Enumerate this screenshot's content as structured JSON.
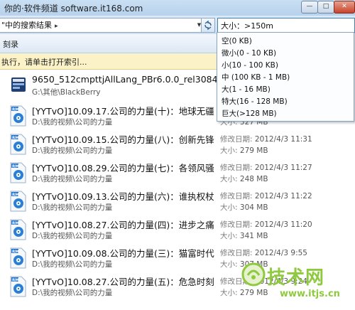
{
  "watermark_top": "你的·软件频道 software.it168.com",
  "window_buttons": {
    "minimize": "—",
    "maximize": "□",
    "close": "✕"
  },
  "address_bar": {
    "text": "\"中的搜索结果",
    "separator": "▸"
  },
  "search": {
    "value": "大小：>150m"
  },
  "toolbar": {
    "label": "刻录"
  },
  "infobar": {
    "text": "执行，请单击打开索引..."
  },
  "size_filter": {
    "options": [
      "空(0 KB)",
      "微小(0 - 10 KB)",
      "小(10 - 100 KB)",
      "中 (100 KB - 1 MB)",
      "大(1 - 16 MB)",
      "特大(16 - 128 MB)",
      "巨大(>128 MB)"
    ]
  },
  "files": [
    {
      "name": "9650_512cmpttjAllLang_PBr6.0.0_rel3084...",
      "path": "G:\\其他\\BlackBerry",
      "date_label": "",
      "date": "",
      "size_label": "",
      "size": "",
      "icon": "blackberry-package-icon"
    },
    {
      "name": "[YYTvO]10.09.17.公司的力量(十)：地球无疆",
      "path": "D:\\我的视频\\公司的力量",
      "date_label": "",
      "date": "",
      "size_label": "大小:",
      "size": "327 MB",
      "icon": "rm-video-file-icon"
    },
    {
      "name": "[YYTvO]10.09.15.公司的力量(八)：创新先锋",
      "path": "D:\\我的视频\\公司的力量",
      "date_label": "修改日期:",
      "date": "2012/4/3 11:31",
      "size_label": "大小:",
      "size": "279 MB",
      "icon": "rm-video-file-icon"
    },
    {
      "name": "[YYTvO]10.08.29.公司的力量(七)：各领风骚",
      "path": "D:\\我的视频\\公司的力量",
      "date_label": "修改日期:",
      "date": "2012/4/3 11:27",
      "size_label": "大小:",
      "size": "248 MB",
      "icon": "rm-video-file-icon"
    },
    {
      "name": "[YYTvO]10.09.13.公司的力量(六)：谁执权杖",
      "path": "D:\\我的视频\\公司的力量",
      "date_label": "修改日期:",
      "date": "2012/4/3 11:22",
      "size_label": "大小:",
      "size": "304 MB",
      "icon": "rm-video-file-icon"
    },
    {
      "name": "[YYTvO]10.08.27.公司的力量(四)：进步之痛",
      "path": "D:\\我的视频\\公司的力量",
      "date_label": "修改日期:",
      "date": "2012/4/3 11:20",
      "size_label": "大小:",
      "size": "341 MB",
      "icon": "rm-video-file-icon"
    },
    {
      "name": "[YYTvO]10.09.08.公司的力量(三)：猫富时代",
      "path": "D:\\我的视频\\公司的力量",
      "date_label": "修改日期:",
      "date": "2012/4/3 9:55",
      "size_label": "大小:",
      "size": "307 MB",
      "icon": "rm-video-file-icon"
    },
    {
      "name": "[YYTvO]10.08.27.公司的力量(五)：危急时刻",
      "path": "D:\\我的视频\\公司的力量",
      "date_label": "修改日期:",
      "date": "2012/4/3 9:24",
      "size_label": "大小:",
      "size": "279 MB",
      "icon": "rm-video-file-icon"
    }
  ],
  "watermark_bottom": {
    "big": "技术网",
    "url": "www.itjs.cn"
  },
  "colors": {
    "accent": "#3c7fb1",
    "infobar": "#fbf3c7",
    "watermark": "#8fc93f",
    "rm_icon_blue": "#1f6fc9"
  }
}
